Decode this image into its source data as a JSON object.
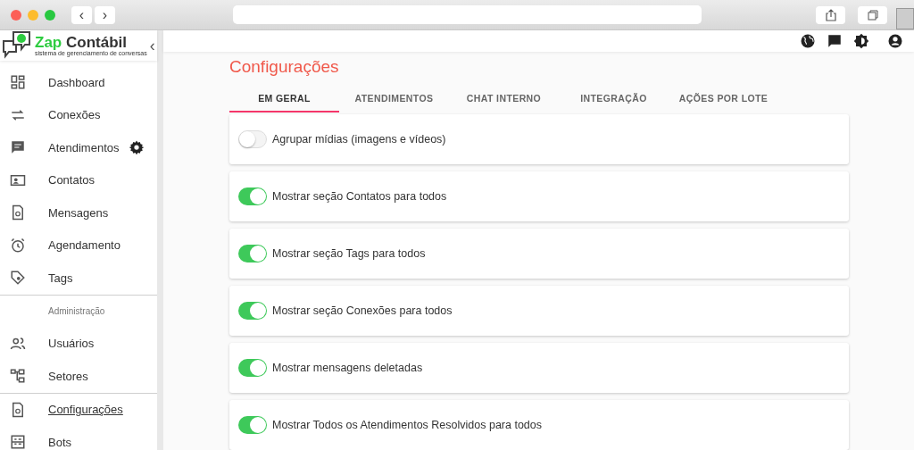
{
  "browser": {
    "nav_buttons": [
      "‹",
      "›"
    ]
  },
  "logo": {
    "brand_a": "Zap",
    "brand_b": "Contábil",
    "tagline": "sistema de gerenciamento de conversas",
    "collapse": "‹"
  },
  "sidebar": {
    "items": [
      {
        "label": "Dashboard",
        "selected": false
      },
      {
        "label": "Conexões",
        "selected": false
      },
      {
        "label": "Atendimentos",
        "selected": false,
        "gear": true
      },
      {
        "label": "Contatos",
        "selected": false
      },
      {
        "label": "Mensagens",
        "selected": false
      },
      {
        "label": "Agendamento",
        "selected": false
      },
      {
        "label": "Tags",
        "selected": false
      },
      {
        "kind": "divider"
      },
      {
        "kind": "header",
        "label": "Administração"
      },
      {
        "label": "Usuários",
        "selected": false
      },
      {
        "label": "Setores",
        "selected": false
      },
      {
        "kind": "divider"
      },
      {
        "label": "Configurações",
        "selected": true
      },
      {
        "label": "Bots",
        "selected": false
      }
    ]
  },
  "page": {
    "title": "Configurações",
    "tabs": [
      {
        "label": "EM GERAL",
        "selected": true
      },
      {
        "label": "ATENDIMENTOS",
        "selected": false
      },
      {
        "label": "CHAT INTERNO",
        "selected": false
      },
      {
        "label": "INTEGRAÇÃO",
        "selected": false
      },
      {
        "label": "AÇÕES POR LOTE",
        "selected": false
      }
    ],
    "settings": [
      {
        "label": "Agrupar mídias (imagens e vídeos)",
        "on": false
      },
      {
        "label": "Mostrar seção Contatos para todos",
        "on": true
      },
      {
        "label": "Mostrar seção Tags para todos",
        "on": true
      },
      {
        "label": "Mostrar seção Conexões para todos",
        "on": true
      },
      {
        "label": "Mostrar mensagens deletadas",
        "on": true
      },
      {
        "label": "Mostrar Todos os Atendimentos Resolvidos para todos",
        "on": true
      }
    ]
  }
}
